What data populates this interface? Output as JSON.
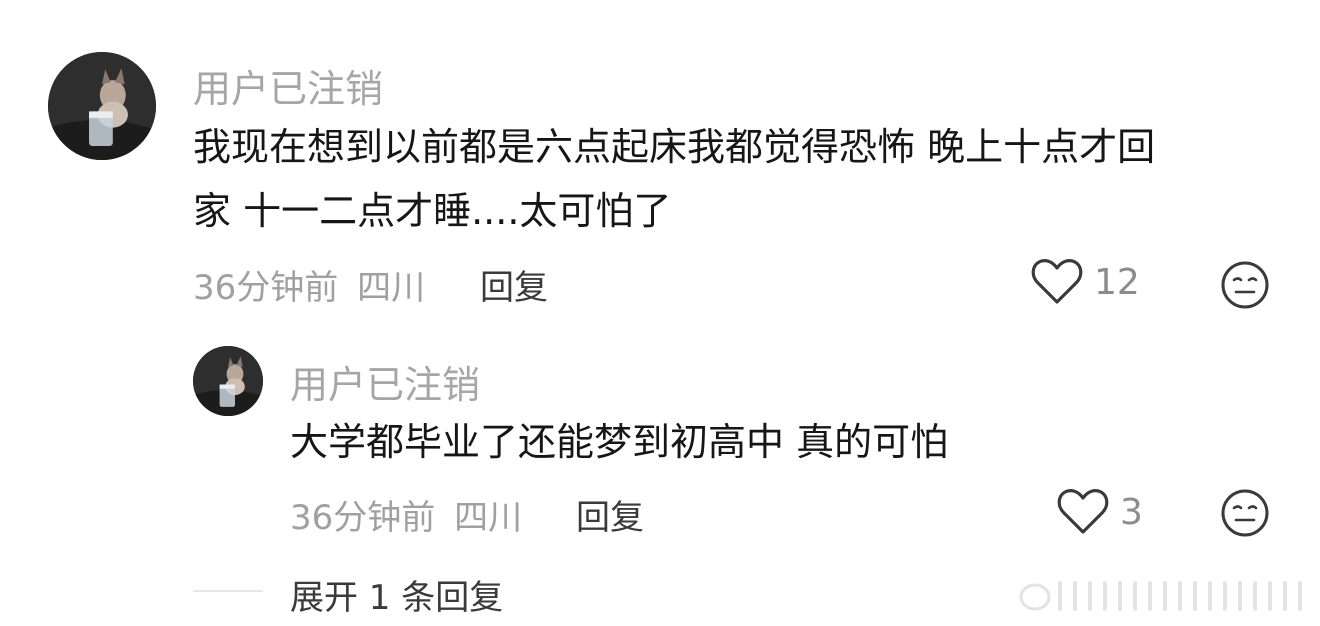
{
  "comment": {
    "username": "用户已注销",
    "text_line1": "我现在想到以前都是六点起床我都觉得恐怖 晚上十点才回",
    "text_line2": "家 十一二点才睡....太可怕了",
    "time": "36分钟前",
    "location": "四川",
    "reply_label": "回复",
    "like_count": "12"
  },
  "reply": {
    "username": "用户已注销",
    "text": "大学都毕业了还能梦到初高中 真的可怕",
    "time": "36分钟前",
    "location": "四川",
    "reply_label": "回复",
    "like_count": "3"
  },
  "expand_label": "展开 1 条回复",
  "icons": {
    "avatar": "cat-avatar",
    "like": "heart-outline-icon",
    "dislike": "meh-face-icon"
  }
}
